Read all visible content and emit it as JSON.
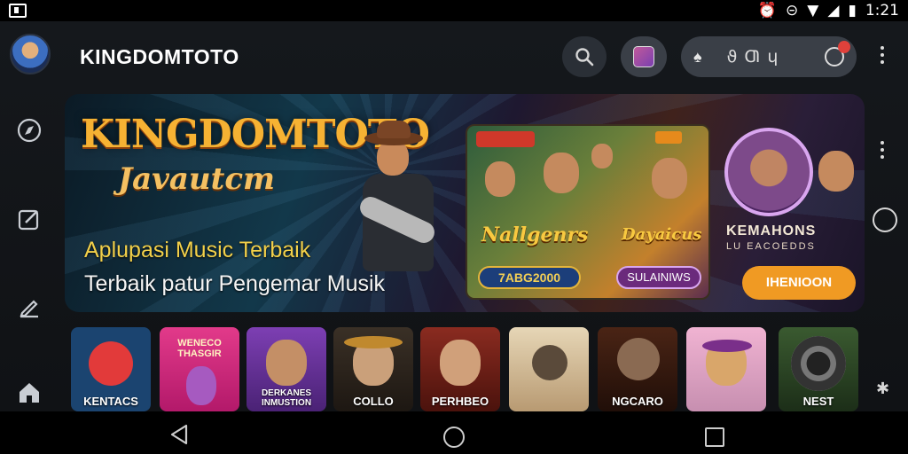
{
  "status_bar": {
    "time": "1:21"
  },
  "header": {
    "title": "KINGDOMTOTO",
    "pill_text": "ϑ Ƣ ɥ",
    "notif_badge": ""
  },
  "hero": {
    "logo": "KINGDOMTOTO",
    "script": "Javautcm",
    "line1": "Aplupasi Music Terbaik",
    "line2": "Terbaik patur Pengemar Musik",
    "poster1": {
      "tag": "",
      "title_left": "Nallgenrs",
      "title_right": "Dayaicus",
      "button_left": "7ABG2000",
      "button_right": "SULAINIWS"
    },
    "poster2": {
      "title": "KEMAHONS",
      "subtitle": "LU EACOEDDS",
      "button": "IHENIOON"
    }
  },
  "tiles": [
    {
      "label": "KENTACS",
      "bg": "#1b4470"
    },
    {
      "label": "",
      "top_text": "WENECO\nTHASGIR",
      "bg": "#d9287a"
    },
    {
      "label": "DERKANES\nINMUSTION",
      "bg": "#5a2d86"
    },
    {
      "label": "COLLO",
      "bg": "#2b2420"
    },
    {
      "label": "PERHBEO",
      "bg": "#7a2018"
    },
    {
      "label": "",
      "bg": "#d8c4a2"
    },
    {
      "label": "NGCARO",
      "bg": "#3b1c12"
    },
    {
      "label": "",
      "bg": "#e3a7c8"
    },
    {
      "label": "NEST",
      "bg": "#2f4f2a"
    }
  ],
  "colors": {
    "accent": "#f09a23",
    "gold": "#f6b233",
    "badge": "#e0413b"
  }
}
